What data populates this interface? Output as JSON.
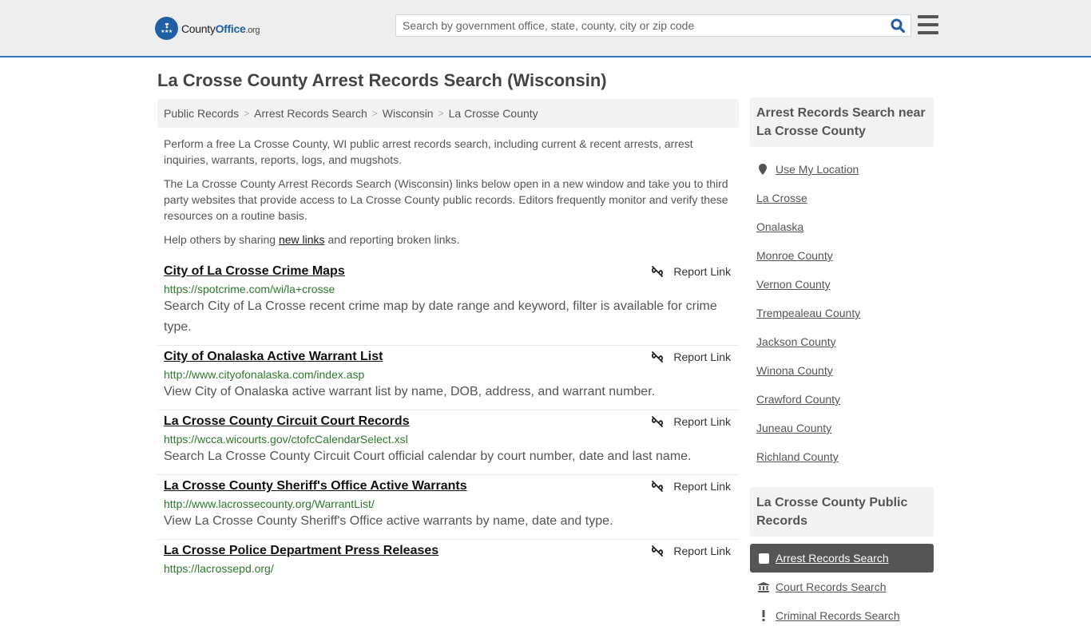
{
  "header": {
    "logo": {
      "brand_left": "County",
      "brand_right": "Office",
      "tld": ".org",
      "wings": "❣",
      "stars": "★★★"
    },
    "search": {
      "placeholder": "Search by government office, state, county, city or zip code",
      "value": ""
    },
    "icons": {
      "search": "search-icon",
      "menu": "hamburger-menu-icon"
    },
    "accent_color": "#2e75b6"
  },
  "page": {
    "title": "La Crosse County Arrest Records Search (Wisconsin)"
  },
  "breadcrumb": [
    {
      "label": "Public Records"
    },
    {
      "label": "Arrest Records Search"
    },
    {
      "label": "Wisconsin"
    },
    {
      "label": "La Crosse County"
    }
  ],
  "breadcrumb_separator": ">",
  "intro": {
    "p1": "Perform a free La Crosse County, WI public arrest records search, including current & recent arrests, arrest inquiries, warrants, reports, logs, and mugshots.",
    "p2": "The La Crosse County Arrest Records Search (Wisconsin) links below open in a new window and take you to third party websites that provide access to La Crosse County public records. Editors frequently monitor and verify these resources on a routine basis.",
    "p3_before": "Help others by sharing ",
    "p3_link": "new links",
    "p3_after": " and reporting broken links."
  },
  "report_link_label": "Report Link",
  "results": [
    {
      "title": "City of La Crosse Crime Maps",
      "url": "https://spotcrime.com/wi/la+crosse",
      "description": "Search City of La Crosse recent crime map by date range and keyword, filter is available for crime type."
    },
    {
      "title": "City of Onalaska Active Warrant List",
      "url": "http://www.cityofonalaska.com/index.asp",
      "description": "View City of Onalaska active warrant list by name, DOB, address, and warrant number."
    },
    {
      "title": "La Crosse County Circuit Court Records",
      "url": "https://wcca.wicourts.gov/ctofcCalendarSelect.xsl",
      "description": "Search La Crosse County Circuit Court official calendar by court number, date and last name."
    },
    {
      "title": "La Crosse County Sheriff's Office Active Warrants",
      "url": "http://www.lacrossecounty.org/WarrantList/",
      "description": "View La Crosse County Sheriff's Office active warrants by name, date and type."
    },
    {
      "title": "La Crosse Police Department Press Releases",
      "url": "https://lacrossepd.org/",
      "description": ""
    }
  ],
  "sidebar": {
    "nearby_heading": "Arrest Records Search near La Crosse County",
    "use_location": "Use My Location",
    "nearby": [
      {
        "label": "La Crosse"
      },
      {
        "label": "Onalaska"
      },
      {
        "label": "Monroe County"
      },
      {
        "label": "Vernon County"
      },
      {
        "label": "Trempealeau County"
      },
      {
        "label": "Jackson County"
      },
      {
        "label": "Winona County"
      },
      {
        "label": "Crawford County"
      },
      {
        "label": "Juneau County"
      },
      {
        "label": "Richland County"
      }
    ],
    "records_heading": "La Crosse County Public Records",
    "records_nav": [
      {
        "label": "Arrest Records Search",
        "icon": "square-icon",
        "active": true
      },
      {
        "label": "Court Records Search",
        "icon": "courthouse-icon",
        "active": false
      },
      {
        "label": "Criminal Records Search",
        "icon": "exclamation-icon",
        "active": false
      }
    ]
  }
}
